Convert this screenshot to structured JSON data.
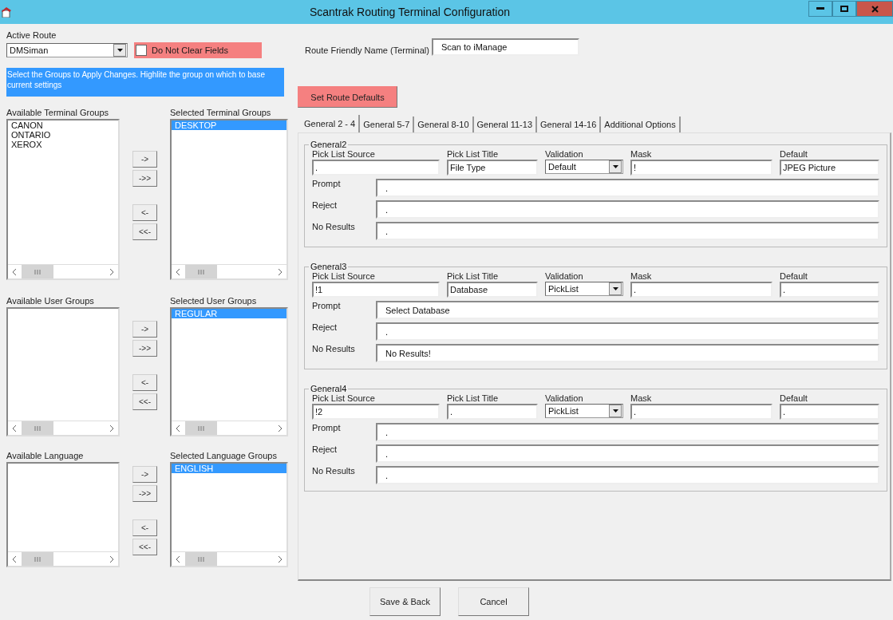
{
  "window": {
    "title": "Scantrak Routing Terminal Configuration"
  },
  "active_route": {
    "label": "Active Route",
    "value": "DMSiman"
  },
  "do_not_clear": {
    "label": "Do Not Clear Fields",
    "checked": false
  },
  "info_text": "Select the Groups to Apply Changes. Highlite the group on which to base current settings",
  "group_sections": [
    {
      "available_label": "Available Terminal Groups",
      "available_items": [
        {
          "label": "CANON",
          "selected": false
        },
        {
          "label": "ONTARIO",
          "selected": false
        },
        {
          "label": "XEROX",
          "selected": false
        }
      ],
      "selected_label": "Selected Terminal Groups",
      "selected_items": [
        {
          "label": "DESKTOP",
          "selected": true
        }
      ],
      "move_buttons": [
        "->",
        "->>",
        "<-",
        "<<-"
      ]
    },
    {
      "available_label": "Available User Groups",
      "selected_label": "Selected User Groups",
      "selected_items": [
        {
          "label": "REGULAR",
          "selected": true
        }
      ],
      "move_buttons": [
        "->",
        "->>",
        "<-",
        "<<-"
      ]
    },
    {
      "available_label": "Available Language",
      "selected_label": "Selected Language Groups",
      "selected_items": [
        {
          "label": "ENGLISH",
          "selected": true
        }
      ],
      "move_buttons": [
        "->",
        "->>",
        "<-",
        "<<-"
      ]
    }
  ],
  "route_name": {
    "label": "Route Friendly Name (Terminal)",
    "value": "Scan to iManage"
  },
  "set_defaults_button": "Set Route Defaults",
  "tabs": [
    {
      "label": "General 2 - 4",
      "selected": true
    },
    {
      "label": "General 5-7",
      "selected": false
    },
    {
      "label": "General 8-10",
      "selected": false
    },
    {
      "label": "General 11-13",
      "selected": false
    },
    {
      "label": "General 14-16",
      "selected": false
    },
    {
      "label": "Additional Options",
      "selected": false
    }
  ],
  "general_groups": [
    {
      "title": "General2",
      "fields": [
        {
          "label": "Pick List Source",
          "value": ".",
          "kind": "text"
        },
        {
          "label": "Pick List Title",
          "value": "File Type",
          "kind": "text"
        },
        {
          "label": "Validation",
          "value": "Default",
          "kind": "select"
        },
        {
          "label": "Mask",
          "value": "!",
          "kind": "text"
        },
        {
          "label": "Default",
          "value": "JPEG Picture",
          "kind": "text"
        }
      ],
      "rows": [
        {
          "label": "Prompt",
          "value": "."
        },
        {
          "label": "Reject",
          "value": "."
        },
        {
          "label": "No Results",
          "value": "."
        }
      ]
    },
    {
      "title": "General3",
      "fields": [
        {
          "label": "Pick List Source",
          "value": "!1",
          "kind": "text"
        },
        {
          "label": "Pick List Title",
          "value": "Database",
          "kind": "text"
        },
        {
          "label": "Validation",
          "value": "PickList",
          "kind": "select"
        },
        {
          "label": "Mask",
          "value": ".",
          "kind": "text"
        },
        {
          "label": "Default",
          "value": ".",
          "kind": "text"
        }
      ],
      "rows": [
        {
          "label": "Prompt",
          "value": "Select Database"
        },
        {
          "label": "Reject",
          "value": "."
        },
        {
          "label": "No Results",
          "value": "No Results!"
        }
      ]
    },
    {
      "title": "General4",
      "fields": [
        {
          "label": "Pick List Source",
          "value": "!2",
          "kind": "text"
        },
        {
          "label": "Pick List Title",
          "value": ".",
          "kind": "text"
        },
        {
          "label": "Validation",
          "value": "PickList",
          "kind": "select"
        },
        {
          "label": "Mask",
          "value": ".",
          "kind": "text"
        },
        {
          "label": "Default",
          "value": ".",
          "kind": "text"
        }
      ],
      "rows": [
        {
          "label": "Prompt",
          "value": "."
        },
        {
          "label": "Reject",
          "value": "."
        },
        {
          "label": "No Results",
          "value": "."
        }
      ]
    }
  ],
  "buttons": [
    "Save & Back",
    "Cancel"
  ]
}
